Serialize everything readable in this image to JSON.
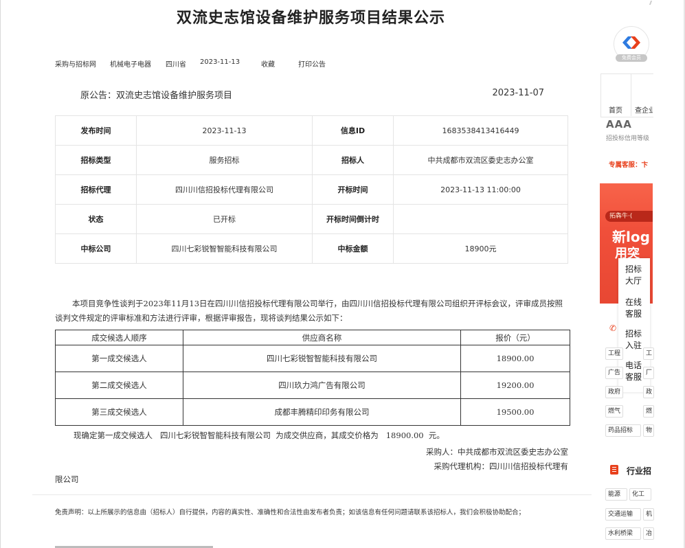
{
  "page": {
    "title": "双流史志馆设备维护服务项目结果公示",
    "meta": [
      "采购与招标网",
      "机械电子电器",
      "四川省",
      "2023-11-13",
      "收藏",
      "打印公告"
    ],
    "original": {
      "label": "原公告：双流史志馆设备维护服务项目",
      "date": "2023-11-07"
    }
  },
  "info_table": [
    [
      "发布时间",
      "2023-11-13",
      "信息ID",
      "1683538413416449"
    ],
    [
      "招标类型",
      "服务招标",
      "招标人",
      "中共成都市双流区委史志办公室"
    ],
    [
      "招标代理",
      "四川川信招投标代理有限公司",
      "开标时间",
      "2023-11-13 11:00:00"
    ],
    [
      "状态",
      "已开标",
      "开标时间倒计时",
      ""
    ],
    [
      "中标公司",
      "四川七彩锐智智能科技有限公司",
      "中标金额",
      "18900元"
    ]
  ],
  "announcement": "本项目竞争性谈判于2023年11月13日在四川川信招投标代理有限公司举行，由四川川信招投标代理有限公司组织开评标会议，评审成员按照谈判文件规定的评审标准和方法进行评审，根据评审报告，现将谈判结果公示如下：",
  "candidates": {
    "headers": [
      "成交候选人顺序",
      "供应商名称",
      "报价（元）"
    ],
    "rows": [
      [
        "第一成交候选人",
        "四川七彩锐智智能科技有限公司",
        "18900.00"
      ],
      [
        "第二成交候选人",
        "四川玖力鸿广告有限公司",
        "19200.00"
      ],
      [
        "第三成交候选人",
        "成都丰腾精印印务有限公司",
        "19500.00"
      ]
    ]
  },
  "result_line": "现确定第一成交候选人   四川七彩锐智智能科技有限公司  为成交供应商，其成交价格为   18900.00  元。",
  "buyer_line": "采购人：中共成都市双流区委史志办公室",
  "agency_line1": "采购代理机构：四川川信招投标代理有",
  "agency_line2": "限公司",
  "disclaimer": "免责声明：以上所展示的信息由（招标人）自行提供，内容的真实性、准确性和合法性由发布者负责；如该信息有任何问题请联系该招标人，我们会积极协助配合；",
  "sidebar": {
    "vip_badge": "免费会员",
    "nav": [
      "首页",
      "查企业"
    ],
    "rating": "AAA",
    "credit_text": "招投标信用等级",
    "service": "专属客服：卞",
    "ad_tag": "拓犇牛·(",
    "ad_big": "新log",
    "ad_sub": "用突",
    "float_menu": [
      "招标大厅",
      "在线客服",
      "招标入驻",
      "电话客服"
    ],
    "tags_top": [
      [
        "工程",
        "工"
      ],
      [
        "广告",
        "厂"
      ],
      [
        "政府",
        "政"
      ],
      [
        "燃气",
        "燃"
      ]
    ],
    "tags_row5": [
      "药品招标",
      "物"
    ],
    "industry_title": "行业招",
    "industry_tags": [
      [
        "能源",
        "化工"
      ],
      [
        "交通运输",
        "机"
      ],
      [
        "水利桥梁",
        "冶"
      ]
    ],
    "accent": "#e8401c"
  }
}
